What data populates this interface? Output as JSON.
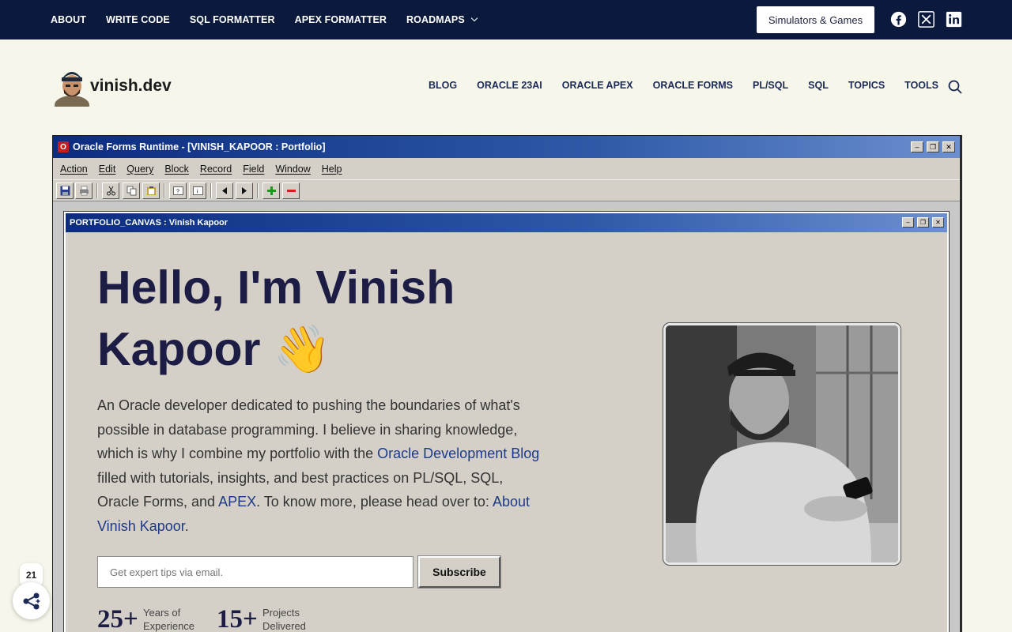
{
  "topbar": {
    "nav": [
      {
        "label": "ABOUT"
      },
      {
        "label": "WRITE CODE"
      },
      {
        "label": "SQL FORMATTER"
      },
      {
        "label": "APEX FORMATTER"
      },
      {
        "label": "ROADMAPS"
      }
    ],
    "cta_label": "Simulators & Games",
    "social": [
      "facebook-icon",
      "x-icon",
      "linkedin-icon"
    ]
  },
  "header": {
    "site_name": "vinish.dev",
    "nav": [
      {
        "label": "BLOG"
      },
      {
        "label": "ORACLE 23AI"
      },
      {
        "label": "ORACLE APEX"
      },
      {
        "label": "ORACLE FORMS"
      },
      {
        "label": "PL/SQL"
      },
      {
        "label": "SQL"
      },
      {
        "label": "TOPICS"
      },
      {
        "label": "TOOLS"
      }
    ]
  },
  "forms_window": {
    "title": "Oracle Forms Runtime - [VINISH_KAPOOR : Portfolio]",
    "app_icon_letter": "O",
    "menu": [
      "Action",
      "Edit",
      "Query",
      "Block",
      "Record",
      "Field",
      "Window",
      "Help"
    ],
    "canvas_title": "PORTFOLIO_CANVAS : Vinish Kapoor"
  },
  "hero": {
    "title_line1": "Hello, I'm Vinish",
    "title_line2": "Kapoor",
    "wave_emoji": "👋",
    "text_1": "An Oracle developer dedicated to pushing the boundaries of what's possible in database programming. I believe in sharing knowledge, which is why I combine my portfolio with the ",
    "link_blog": "Oracle Development Blog",
    "text_2": " filled with tutorials, insights, and best practices on PL/SQL, SQL, Oracle Forms, and ",
    "link_apex": "APEX",
    "text_3": ". To know more, please head over to: ",
    "link_about": "About Vinish Kapoor",
    "text_4": "."
  },
  "subscribe": {
    "placeholder": "Get expert tips via email.",
    "button_label": "Subscribe"
  },
  "stats": [
    {
      "value": "25+",
      "label_1": "Years of",
      "label_2": "Experience"
    },
    {
      "value": "15+",
      "label_1": "Projects",
      "label_2": "Delivered"
    }
  ],
  "share": {
    "count": "21"
  },
  "colors": {
    "topbar_bg": "#0b1a3c",
    "page_bg": "#f6f6ea",
    "title_blue": "#0c2c80",
    "heading": "#1c1c44",
    "link": "#1d3a8a"
  }
}
